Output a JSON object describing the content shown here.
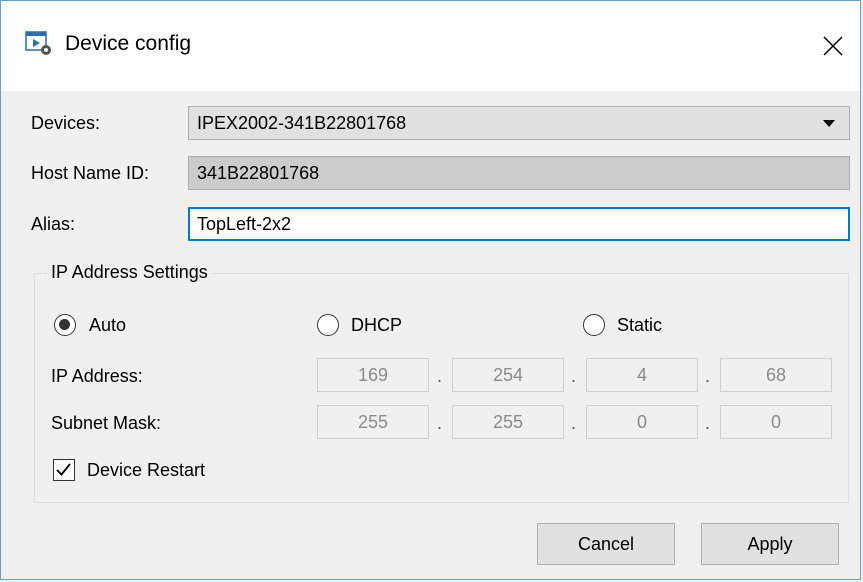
{
  "window": {
    "title": "Device config"
  },
  "devices": {
    "label": "Devices:",
    "value": "IPEX2002-341B22801768"
  },
  "host": {
    "label": "Host Name ID:",
    "value": "341B22801768"
  },
  "alias": {
    "label": "Alias:",
    "value": "TopLeft-2x2"
  },
  "ip_settings": {
    "title": "IP Address Settings",
    "modes": [
      {
        "label": "Auto",
        "selected": true
      },
      {
        "label": "DHCP",
        "selected": false
      },
      {
        "label": "Static",
        "selected": false
      }
    ],
    "ip_address": {
      "label": "IP Address:",
      "octets": [
        "169",
        "254",
        "4",
        "68"
      ]
    },
    "subnet_mask": {
      "label": "Subnet Mask:",
      "octets": [
        "255",
        "255",
        "0",
        "0"
      ]
    },
    "separator": ".",
    "restart": {
      "label": "Device Restart",
      "checked": true
    }
  },
  "buttons": {
    "cancel": "Cancel",
    "apply": "Apply"
  },
  "colors": {
    "focus_border": "#0078d7",
    "window_border": "#6e9fc9"
  }
}
